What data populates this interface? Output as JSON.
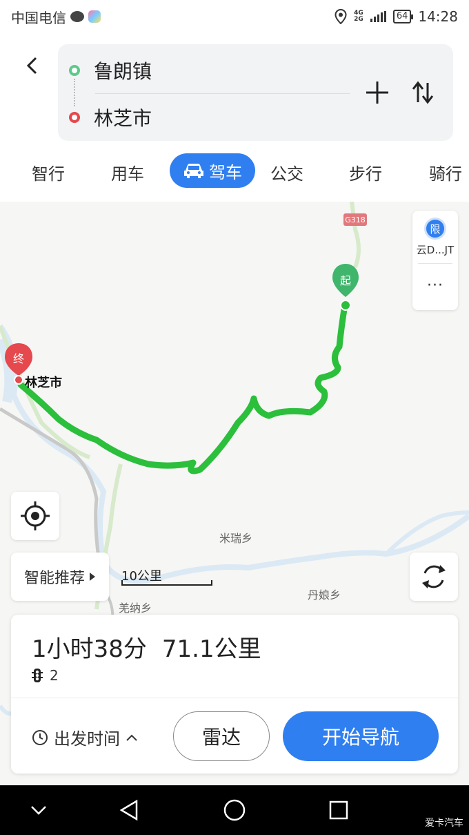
{
  "status_bar": {
    "carrier": "中国电信",
    "network": "4G",
    "network2": "2G",
    "battery": "64",
    "time": "14:28"
  },
  "route": {
    "from": "鲁朗镇",
    "to": "林芝市"
  },
  "tabs": [
    {
      "label": "智行"
    },
    {
      "label": "用车"
    },
    {
      "label": "驾车"
    },
    {
      "label": "公交"
    },
    {
      "label": "步行"
    },
    {
      "label": "骑行"
    }
  ],
  "map": {
    "road_badge": "G318",
    "start_marker": "起",
    "end_marker": "终",
    "city_label": "林芝市",
    "places": [
      "米瑞乡",
      "丹娘乡",
      "羌纳乡"
    ],
    "route_color": "#2bbf3c"
  },
  "side_panel": {
    "limit_icon": "限",
    "limit_label": "云D...JT",
    "more": "···"
  },
  "controls": {
    "smart_label": "智能推荐",
    "scale": "10公里"
  },
  "summary": {
    "duration": "1小时38分",
    "distance": "71.1公里",
    "traffic_lights": "2"
  },
  "actions": {
    "depart_label": "出发时间",
    "radar_label": "雷达",
    "nav_label": "开始导航"
  },
  "watermark": "爱卡汽车"
}
